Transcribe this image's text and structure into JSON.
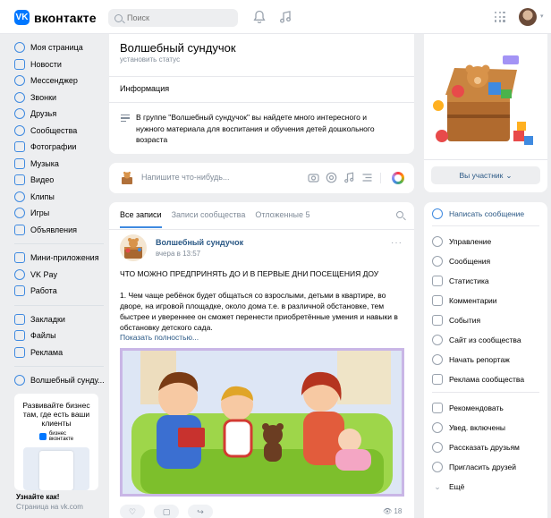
{
  "header": {
    "logo_text": "вконтакте",
    "search_placeholder": "Поиск",
    "icons": [
      "bell-icon",
      "music-icon",
      "apps-grid-icon"
    ]
  },
  "leftnav": {
    "items": [
      {
        "label": "Моя страница",
        "icon": "user-icon"
      },
      {
        "label": "Новости",
        "icon": "news-icon"
      },
      {
        "label": "Мессенджер",
        "icon": "chat-icon"
      },
      {
        "label": "Звонки",
        "icon": "phone-icon"
      },
      {
        "label": "Друзья",
        "icon": "friends-icon"
      },
      {
        "label": "Сообщества",
        "icon": "communities-icon"
      },
      {
        "label": "Фотографии",
        "icon": "photo-icon"
      },
      {
        "label": "Музыка",
        "icon": "music-icon"
      },
      {
        "label": "Видео",
        "icon": "video-icon"
      },
      {
        "label": "Клипы",
        "icon": "clips-icon"
      },
      {
        "label": "Игры",
        "icon": "games-icon"
      },
      {
        "label": "Объявления",
        "icon": "ads-icon"
      },
      {
        "label": "Мини-приложения",
        "icon": "mini-apps-icon"
      },
      {
        "label": "VK Pay",
        "icon": "vkpay-icon"
      },
      {
        "label": "Работа",
        "icon": "work-icon"
      },
      {
        "label": "Закладки",
        "icon": "bookmark-icon"
      },
      {
        "label": "Файлы",
        "icon": "file-icon"
      },
      {
        "label": "Реклама",
        "icon": "megaphone-icon"
      },
      {
        "label": "Волшебный сунду...",
        "icon": "group-icon"
      }
    ],
    "ad": {
      "title": "Развивайте бизнес там, где есть ваши клиенты",
      "brand_top": "бизнес",
      "brand_bottom": "вконтакте",
      "footer_title": "Узнайте как!",
      "footer_link": "Страница на vk.com"
    }
  },
  "profile": {
    "name": "Волшебный сундучок",
    "status": "установить статус",
    "info_label": "Информация",
    "info_text": "В группе \"Волшебный сундучок\" вы найдете много интересного и нужного материала для воспитания и обучения детей дошкольного возраста"
  },
  "composer": {
    "placeholder": "Напишите что-нибудь..."
  },
  "feed": {
    "tabs": [
      {
        "label": "Все записи",
        "active": true
      },
      {
        "label": "Записи сообщества"
      },
      {
        "label": "Отложенные",
        "count": "5"
      }
    ],
    "post": {
      "author": "Волшебный сундучок",
      "time": "вчера в 13:57",
      "headline": "ЧТО МОЖНО ПРЕДПРИНЯТЬ ДО И В ПЕРВЫЕ ДНИ ПОСЕЩЕНИЯ ДОУ",
      "body": "1. Чем чаще ребёнок будет общаться со взрослыми, детьми в квартире, во дворе, на игровой площадке, около дома т.е. в различной обстановке, тем быстрее и увереннее он сможет перенести приобретённые умения и навыки в обстановку детского сада.",
      "show_more": "Показать полностью...",
      "views": "18"
    }
  },
  "right": {
    "member_button": "Вы участник",
    "actions": [
      {
        "label": "Написать сообщение",
        "icon": "message-icon",
        "primary": true
      },
      {
        "label": "Управление",
        "icon": "settings-icon"
      },
      {
        "label": "Сообщения",
        "icon": "chat-icon"
      },
      {
        "label": "Статистика",
        "icon": "stats-icon"
      },
      {
        "label": "Комментарии",
        "icon": "comment-icon"
      },
      {
        "label": "События",
        "icon": "events-icon"
      },
      {
        "label": "Сайт из сообщества",
        "icon": "globe-icon"
      },
      {
        "label": "Начать репортаж",
        "icon": "live-icon"
      },
      {
        "label": "Реклама сообщества",
        "icon": "megaphone-icon"
      },
      {
        "label": "Рекомендовать",
        "icon": "like-icon"
      },
      {
        "label": "Увед. включены",
        "icon": "bell-icon"
      },
      {
        "label": "Рассказать друзьям",
        "icon": "share-icon"
      },
      {
        "label": "Пригласить друзей",
        "icon": "invite-icon"
      },
      {
        "label": "Ещё",
        "icon": "chevron-down-icon"
      }
    ]
  }
}
